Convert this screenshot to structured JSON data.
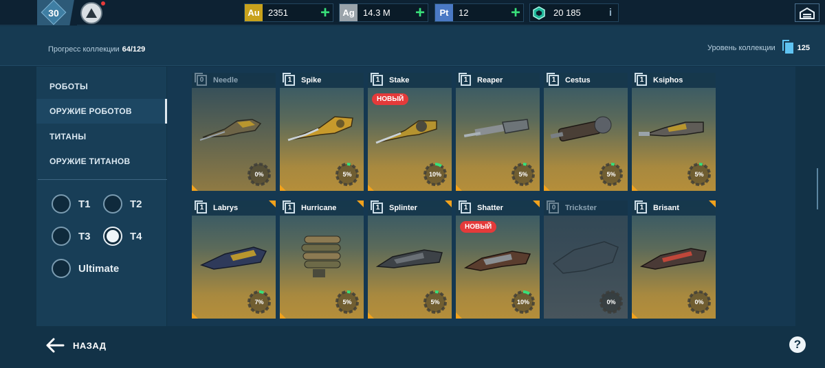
{
  "topbar": {
    "player_level": "30",
    "currencies": [
      {
        "code": "Au",
        "value": "2351",
        "icon_color": "#c8a21c",
        "action": "plus"
      },
      {
        "code": "Ag",
        "value": "14.3 M",
        "icon_color": "#9aa3aa",
        "action": "plus"
      },
      {
        "code": "Pt",
        "value": "12",
        "icon_color": "#4a79c4",
        "action": "plus"
      },
      {
        "code": "",
        "value": "20 185",
        "icon_color": "#1fb79a",
        "action": "info"
      }
    ],
    "plus_glyph": "+",
    "info_glyph": "i"
  },
  "header": {
    "progress_label": "Прогресс коллекции",
    "progress_value": "64/129",
    "collection_level_label": "Уровень коллекции",
    "collection_level_value": "125"
  },
  "sidebar": {
    "items": [
      {
        "label": "РОБОТЫ",
        "active": false
      },
      {
        "label": "ОРУЖИЕ РОБОТОВ",
        "active": true
      },
      {
        "label": "ТИТАНЫ",
        "active": false
      },
      {
        "label": "ОРУЖИЕ ТИТАНОВ",
        "active": false
      }
    ],
    "tiers": [
      {
        "label": "T1",
        "selected": false
      },
      {
        "label": "T2",
        "selected": false
      },
      {
        "label": "T3",
        "selected": false
      },
      {
        "label": "T4",
        "selected": true
      },
      {
        "label": "Ultimate",
        "selected": false
      }
    ]
  },
  "cards": [
    {
      "name": "Needle",
      "count": "0",
      "percent": "0%",
      "progress": 0,
      "new": false,
      "state": "dim"
    },
    {
      "name": "Spike",
      "count": "1",
      "percent": "5%",
      "progress": 0.05,
      "new": false,
      "state": "normal"
    },
    {
      "name": "Stake",
      "count": "1",
      "percent": "10%",
      "progress": 0.1,
      "new": true,
      "state": "normal"
    },
    {
      "name": "Reaper",
      "count": "1",
      "percent": "5%",
      "progress": 0.05,
      "new": false,
      "state": "normal"
    },
    {
      "name": "Cestus",
      "count": "1",
      "percent": "5%",
      "progress": 0.05,
      "new": false,
      "state": "normal"
    },
    {
      "name": "Ksiphos",
      "count": "1",
      "percent": "5%",
      "progress": 0.05,
      "new": false,
      "state": "normal"
    },
    {
      "name": "Labrys",
      "count": "1",
      "percent": "7%",
      "progress": 0.07,
      "new": false,
      "state": "normal"
    },
    {
      "name": "Hurricane",
      "count": "1",
      "percent": "5%",
      "progress": 0.05,
      "new": false,
      "state": "normal"
    },
    {
      "name": "Splinter",
      "count": "1",
      "percent": "5%",
      "progress": 0.05,
      "new": false,
      "state": "normal"
    },
    {
      "name": "Shatter",
      "count": "1",
      "percent": "10%",
      "progress": 0.1,
      "new": true,
      "state": "normal"
    },
    {
      "name": "Trickster",
      "count": "0",
      "percent": "0%",
      "progress": 0,
      "new": false,
      "state": "grey"
    },
    {
      "name": "Brisant",
      "count": "1",
      "percent": "0%",
      "progress": 0,
      "new": false,
      "state": "normal"
    }
  ],
  "new_badge_label": "НОВЫЙ",
  "footer": {
    "back_label": "НАЗАД",
    "help_glyph": "?"
  },
  "colors": {
    "accent_orange": "#f2a21c",
    "progress_green": "#39e07a",
    "new_red": "#e43a3a"
  }
}
